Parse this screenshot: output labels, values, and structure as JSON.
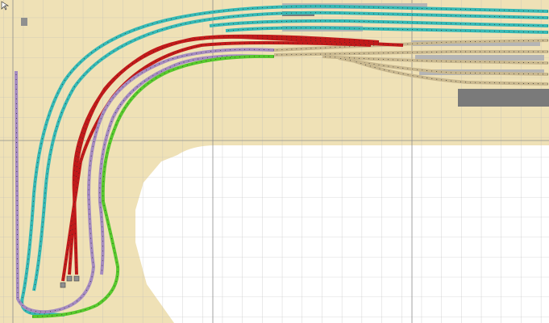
{
  "app": {
    "view": "track-layout-plan"
  },
  "colors": {
    "background": "#ffffff",
    "baseboard": "#efe1b6",
    "grid_line": "#b9b9b9",
    "grid_line_major": "#8c8c8c",
    "tracks": {
      "teal": "#35b9b5",
      "red": "#c11a1a",
      "purple": "#a58bc1",
      "green": "#57c92c",
      "tan": "#c9b88f"
    },
    "station_platform": "#b5b5b5",
    "station_building": "#7a7a7a"
  },
  "track_lines": [
    "teal",
    "red",
    "purple",
    "green",
    "tan"
  ],
  "icons": [
    "cursor-icon",
    "buffer-stop-icon"
  ]
}
